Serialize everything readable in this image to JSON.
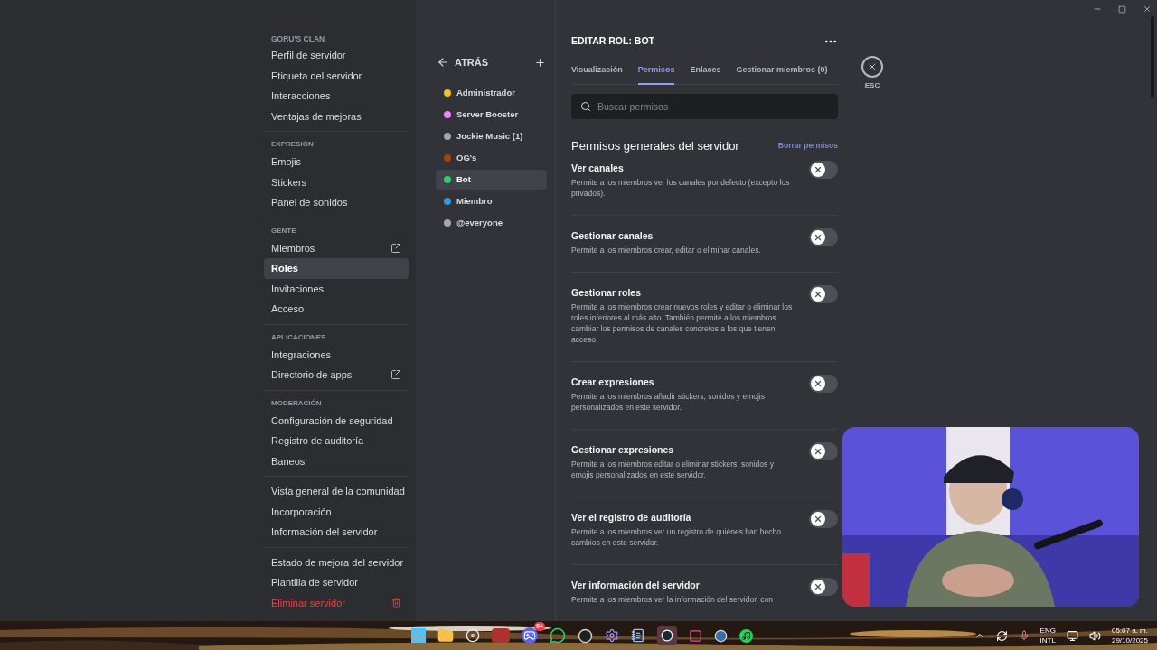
{
  "sidebar": {
    "server_name": "GORU'S CLAN",
    "sections": [
      {
        "items": [
          {
            "label": "Perfil de servidor",
            "selected": false
          },
          {
            "label": "Etiqueta del servidor",
            "selected": false
          },
          {
            "label": "Interacciones",
            "selected": false
          },
          {
            "label": "Ventajas de mejoras",
            "selected": false
          }
        ]
      },
      {
        "heading": "EXPRESIÓN",
        "items": [
          {
            "label": "Emojis",
            "selected": false
          },
          {
            "label": "Stickers",
            "selected": false
          },
          {
            "label": "Panel de sonidos",
            "selected": false
          }
        ]
      },
      {
        "heading": "GENTE",
        "items": [
          {
            "label": "Miembros",
            "selected": false,
            "kind": "external"
          },
          {
            "label": "Roles",
            "selected": true
          },
          {
            "label": "Invitaciones",
            "selected": false
          },
          {
            "label": "Acceso",
            "selected": false
          }
        ]
      },
      {
        "heading": "APLICACIONES",
        "items": [
          {
            "label": "Integraciones",
            "selected": false
          },
          {
            "label": "Directorio de apps",
            "selected": false,
            "kind": "external"
          }
        ]
      },
      {
        "heading": "MODERACIÓN",
        "items": [
          {
            "label": "Configuración de seguridad",
            "selected": false
          },
          {
            "label": "Registro de auditoría",
            "selected": false
          },
          {
            "label": "Baneos",
            "selected": false
          }
        ]
      },
      {
        "items": [
          {
            "label": "Vista general de la comunidad",
            "selected": false
          },
          {
            "label": "Incorporación",
            "selected": false
          },
          {
            "label": "Información del servidor",
            "selected": false
          }
        ]
      },
      {
        "items": [
          {
            "label": "Estado de mejora del servidor",
            "selected": false,
            "kind": "boost"
          },
          {
            "label": "Plantilla de servidor",
            "selected": false
          },
          {
            "label": "Eliminar servidor",
            "selected": false,
            "kind": "danger"
          }
        ]
      }
    ]
  },
  "roles": {
    "back_label": "ATRÁS",
    "items": [
      {
        "name": "Administrador",
        "color": "#f1c40f",
        "selected": false
      },
      {
        "name": "Server Booster",
        "color": "#f47fff",
        "selected": false
      },
      {
        "name": "Jockie Music (1)",
        "color": "#99aab5",
        "selected": false
      },
      {
        "name": "OG's",
        "color": "#a84300",
        "selected": false
      },
      {
        "name": "Bot",
        "color": "#2ecc71",
        "selected": true
      },
      {
        "name": "Miembro",
        "color": "#3498db",
        "selected": false
      },
      {
        "name": "@everyone",
        "color": "#99aab5",
        "selected": false
      }
    ]
  },
  "editor": {
    "title": "EDITAR ROL: BOT",
    "tabs": [
      {
        "label": "Visualización",
        "selected": false
      },
      {
        "label": "Permisos",
        "selected": true
      },
      {
        "label": "Enlaces",
        "selected": false
      },
      {
        "label": "Gestionar miembros (0)",
        "selected": false
      }
    ],
    "close_label": "ESC",
    "search": {
      "placeholder": "Buscar permisos"
    },
    "section_title": "Permisos generales del servidor",
    "clear_label": "Borrar permisos",
    "permissions": [
      {
        "name": "Ver canales",
        "description": "Permite a los miembros ver los canales por defecto (excepto los privados).",
        "on": false
      },
      {
        "name": "Gestionar canales",
        "description": "Permite a los miembros crear, editar o eliminar canales.",
        "on": false
      },
      {
        "name": "Gestionar roles",
        "description": "Permite a los miembros crear nuevos roles y editar o eliminar los roles inferiores al más alto. También permite a los miembros cambiar los permisos de canales concretos a los que tienen acceso.",
        "on": false
      },
      {
        "name": "Crear expresiones",
        "description": "Permite a los miembros añadir stickers, sonidos y emojis personalizados en este servidor.",
        "on": false
      },
      {
        "name": "Gestionar expresiones",
        "description": "Permite a los miembros editar o eliminar stickers, sonidos y emojis personalizados en este servidor.",
        "on": false
      },
      {
        "name": "Ver el registro de auditoría",
        "description": "Permite a los miembros ver un registro de quiénes han hecho cambios en este servidor.",
        "on": false
      },
      {
        "name": "Ver información del servidor",
        "description": "Permite a los miembros ver la información del servidor, con",
        "on": false
      }
    ]
  },
  "taskbar": {
    "badge": "9+",
    "language": [
      "ENG",
      "INTL"
    ],
    "time": "05:07 a. m.",
    "date": "29/10/2025"
  }
}
